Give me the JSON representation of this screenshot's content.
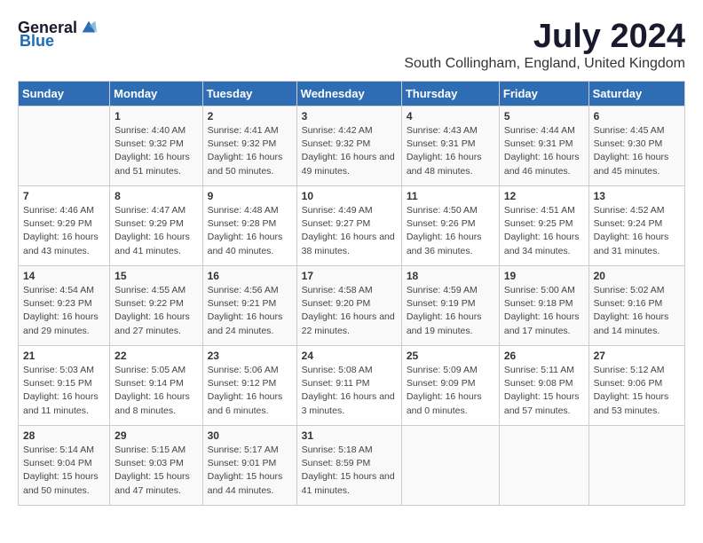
{
  "header": {
    "logo_general": "General",
    "logo_blue": "Blue",
    "title": "July 2024",
    "subtitle": "South Collingham, England, United Kingdom"
  },
  "calendar": {
    "days_of_week": [
      "Sunday",
      "Monday",
      "Tuesday",
      "Wednesday",
      "Thursday",
      "Friday",
      "Saturday"
    ],
    "weeks": [
      [
        {
          "day": "",
          "sunrise": "",
          "sunset": "",
          "daylight": ""
        },
        {
          "day": "1",
          "sunrise": "Sunrise: 4:40 AM",
          "sunset": "Sunset: 9:32 PM",
          "daylight": "Daylight: 16 hours and 51 minutes."
        },
        {
          "day": "2",
          "sunrise": "Sunrise: 4:41 AM",
          "sunset": "Sunset: 9:32 PM",
          "daylight": "Daylight: 16 hours and 50 minutes."
        },
        {
          "day": "3",
          "sunrise": "Sunrise: 4:42 AM",
          "sunset": "Sunset: 9:32 PM",
          "daylight": "Daylight: 16 hours and 49 minutes."
        },
        {
          "day": "4",
          "sunrise": "Sunrise: 4:43 AM",
          "sunset": "Sunset: 9:31 PM",
          "daylight": "Daylight: 16 hours and 48 minutes."
        },
        {
          "day": "5",
          "sunrise": "Sunrise: 4:44 AM",
          "sunset": "Sunset: 9:31 PM",
          "daylight": "Daylight: 16 hours and 46 minutes."
        },
        {
          "day": "6",
          "sunrise": "Sunrise: 4:45 AM",
          "sunset": "Sunset: 9:30 PM",
          "daylight": "Daylight: 16 hours and 45 minutes."
        }
      ],
      [
        {
          "day": "7",
          "sunrise": "Sunrise: 4:46 AM",
          "sunset": "Sunset: 9:29 PM",
          "daylight": "Daylight: 16 hours and 43 minutes."
        },
        {
          "day": "8",
          "sunrise": "Sunrise: 4:47 AM",
          "sunset": "Sunset: 9:29 PM",
          "daylight": "Daylight: 16 hours and 41 minutes."
        },
        {
          "day": "9",
          "sunrise": "Sunrise: 4:48 AM",
          "sunset": "Sunset: 9:28 PM",
          "daylight": "Daylight: 16 hours and 40 minutes."
        },
        {
          "day": "10",
          "sunrise": "Sunrise: 4:49 AM",
          "sunset": "Sunset: 9:27 PM",
          "daylight": "Daylight: 16 hours and 38 minutes."
        },
        {
          "day": "11",
          "sunrise": "Sunrise: 4:50 AM",
          "sunset": "Sunset: 9:26 PM",
          "daylight": "Daylight: 16 hours and 36 minutes."
        },
        {
          "day": "12",
          "sunrise": "Sunrise: 4:51 AM",
          "sunset": "Sunset: 9:25 PM",
          "daylight": "Daylight: 16 hours and 34 minutes."
        },
        {
          "day": "13",
          "sunrise": "Sunrise: 4:52 AM",
          "sunset": "Sunset: 9:24 PM",
          "daylight": "Daylight: 16 hours and 31 minutes."
        }
      ],
      [
        {
          "day": "14",
          "sunrise": "Sunrise: 4:54 AM",
          "sunset": "Sunset: 9:23 PM",
          "daylight": "Daylight: 16 hours and 29 minutes."
        },
        {
          "day": "15",
          "sunrise": "Sunrise: 4:55 AM",
          "sunset": "Sunset: 9:22 PM",
          "daylight": "Daylight: 16 hours and 27 minutes."
        },
        {
          "day": "16",
          "sunrise": "Sunrise: 4:56 AM",
          "sunset": "Sunset: 9:21 PM",
          "daylight": "Daylight: 16 hours and 24 minutes."
        },
        {
          "day": "17",
          "sunrise": "Sunrise: 4:58 AM",
          "sunset": "Sunset: 9:20 PM",
          "daylight": "Daylight: 16 hours and 22 minutes."
        },
        {
          "day": "18",
          "sunrise": "Sunrise: 4:59 AM",
          "sunset": "Sunset: 9:19 PM",
          "daylight": "Daylight: 16 hours and 19 minutes."
        },
        {
          "day": "19",
          "sunrise": "Sunrise: 5:00 AM",
          "sunset": "Sunset: 9:18 PM",
          "daylight": "Daylight: 16 hours and 17 minutes."
        },
        {
          "day": "20",
          "sunrise": "Sunrise: 5:02 AM",
          "sunset": "Sunset: 9:16 PM",
          "daylight": "Daylight: 16 hours and 14 minutes."
        }
      ],
      [
        {
          "day": "21",
          "sunrise": "Sunrise: 5:03 AM",
          "sunset": "Sunset: 9:15 PM",
          "daylight": "Daylight: 16 hours and 11 minutes."
        },
        {
          "day": "22",
          "sunrise": "Sunrise: 5:05 AM",
          "sunset": "Sunset: 9:14 PM",
          "daylight": "Daylight: 16 hours and 8 minutes."
        },
        {
          "day": "23",
          "sunrise": "Sunrise: 5:06 AM",
          "sunset": "Sunset: 9:12 PM",
          "daylight": "Daylight: 16 hours and 6 minutes."
        },
        {
          "day": "24",
          "sunrise": "Sunrise: 5:08 AM",
          "sunset": "Sunset: 9:11 PM",
          "daylight": "Daylight: 16 hours and 3 minutes."
        },
        {
          "day": "25",
          "sunrise": "Sunrise: 5:09 AM",
          "sunset": "Sunset: 9:09 PM",
          "daylight": "Daylight: 16 hours and 0 minutes."
        },
        {
          "day": "26",
          "sunrise": "Sunrise: 5:11 AM",
          "sunset": "Sunset: 9:08 PM",
          "daylight": "Daylight: 15 hours and 57 minutes."
        },
        {
          "day": "27",
          "sunrise": "Sunrise: 5:12 AM",
          "sunset": "Sunset: 9:06 PM",
          "daylight": "Daylight: 15 hours and 53 minutes."
        }
      ],
      [
        {
          "day": "28",
          "sunrise": "Sunrise: 5:14 AM",
          "sunset": "Sunset: 9:04 PM",
          "daylight": "Daylight: 15 hours and 50 minutes."
        },
        {
          "day": "29",
          "sunrise": "Sunrise: 5:15 AM",
          "sunset": "Sunset: 9:03 PM",
          "daylight": "Daylight: 15 hours and 47 minutes."
        },
        {
          "day": "30",
          "sunrise": "Sunrise: 5:17 AM",
          "sunset": "Sunset: 9:01 PM",
          "daylight": "Daylight: 15 hours and 44 minutes."
        },
        {
          "day": "31",
          "sunrise": "Sunrise: 5:18 AM",
          "sunset": "Sunset: 8:59 PM",
          "daylight": "Daylight: 15 hours and 41 minutes."
        },
        {
          "day": "",
          "sunrise": "",
          "sunset": "",
          "daylight": ""
        },
        {
          "day": "",
          "sunrise": "",
          "sunset": "",
          "daylight": ""
        },
        {
          "day": "",
          "sunrise": "",
          "sunset": "",
          "daylight": ""
        }
      ]
    ]
  }
}
